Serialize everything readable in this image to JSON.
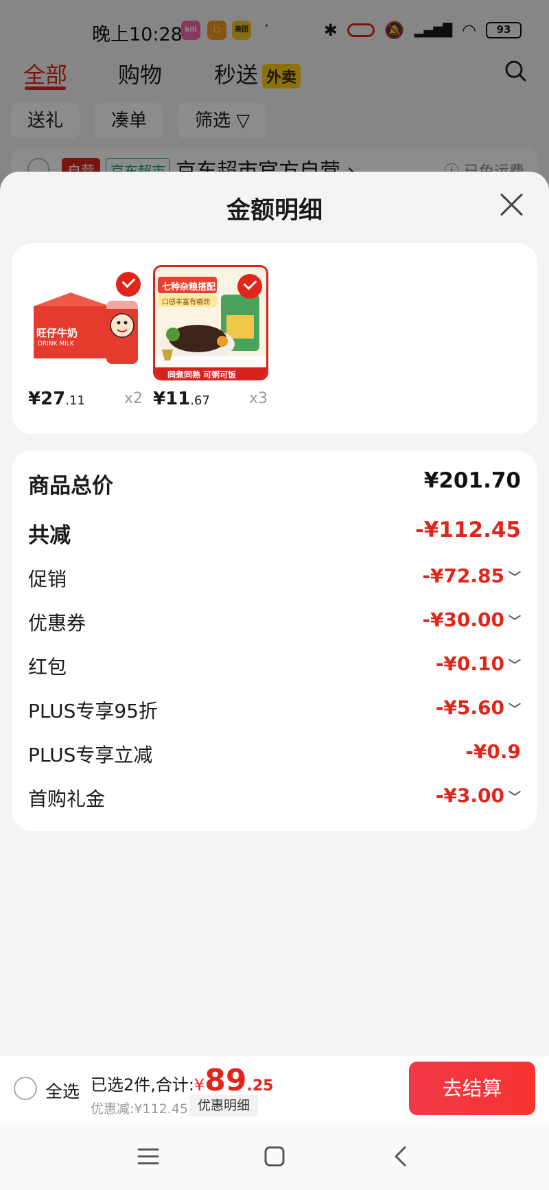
{
  "status_bar": {
    "time": "晚上10:28",
    "app_icons": [
      {
        "label": "bili",
        "color": "#f56ca8"
      },
      {
        "label": "▢",
        "color": "#f39a1e"
      },
      {
        "label": "美团",
        "color": "#f7c520"
      }
    ],
    "battery": "93"
  },
  "top_tabs": [
    {
      "label": "全部"
    },
    {
      "label": "购物"
    },
    {
      "label": "秒送"
    }
  ],
  "waimai_badge": "外卖",
  "chips": [
    "送礼",
    "凑单",
    "筛选"
  ],
  "store": {
    "tag1": "自营",
    "tag2": "京东超市",
    "name": "京东超市官方自营 ›",
    "note": "ⓘ 已免运费"
  },
  "sheet": {
    "title": "金额明细",
    "products": [
      {
        "price_int": "¥27",
        "price_dec": ".11",
        "qty": "x2",
        "img_text": "旺仔牛奶",
        "img_sub": "DRINK MILK",
        "checked": true
      },
      {
        "price_int": "¥11",
        "price_dec": ".67",
        "qty": "x3",
        "img_text": "七种杂粮搭配",
        "img_sub": "口感丰富有嚼劲",
        "img_bottom": "同煮同熟 可粥可饭",
        "checked": true
      }
    ],
    "total_label": "商品总价",
    "total_value": "¥201.70",
    "reduction_label": "共减",
    "reduction_value": "-¥112.45",
    "details": [
      {
        "label": "促销",
        "value": "-¥72.85",
        "expand": true
      },
      {
        "label": "优惠券",
        "value": "-¥30.00",
        "expand": true
      },
      {
        "label": "红包",
        "value": "-¥0.10",
        "expand": true
      },
      {
        "label": "PLUS专享95折",
        "value": "-¥5.60",
        "expand": true
      },
      {
        "label": "PLUS专享立减",
        "value": "-¥0.9",
        "expand": false
      },
      {
        "label": "首购礼金",
        "value": "-¥3.00",
        "expand": true
      }
    ]
  },
  "bottom": {
    "select_all": "全选",
    "selected_text": "已选2件,合计:",
    "currency": "¥",
    "amount_int": "89",
    "amount_dec": ".25",
    "discount_text": "优惠减:¥112.45",
    "detail_button": "优惠明细",
    "checkout": "去结算"
  },
  "colors": {
    "accent": "#e1251b",
    "green_tag": "#1aaa6a"
  }
}
